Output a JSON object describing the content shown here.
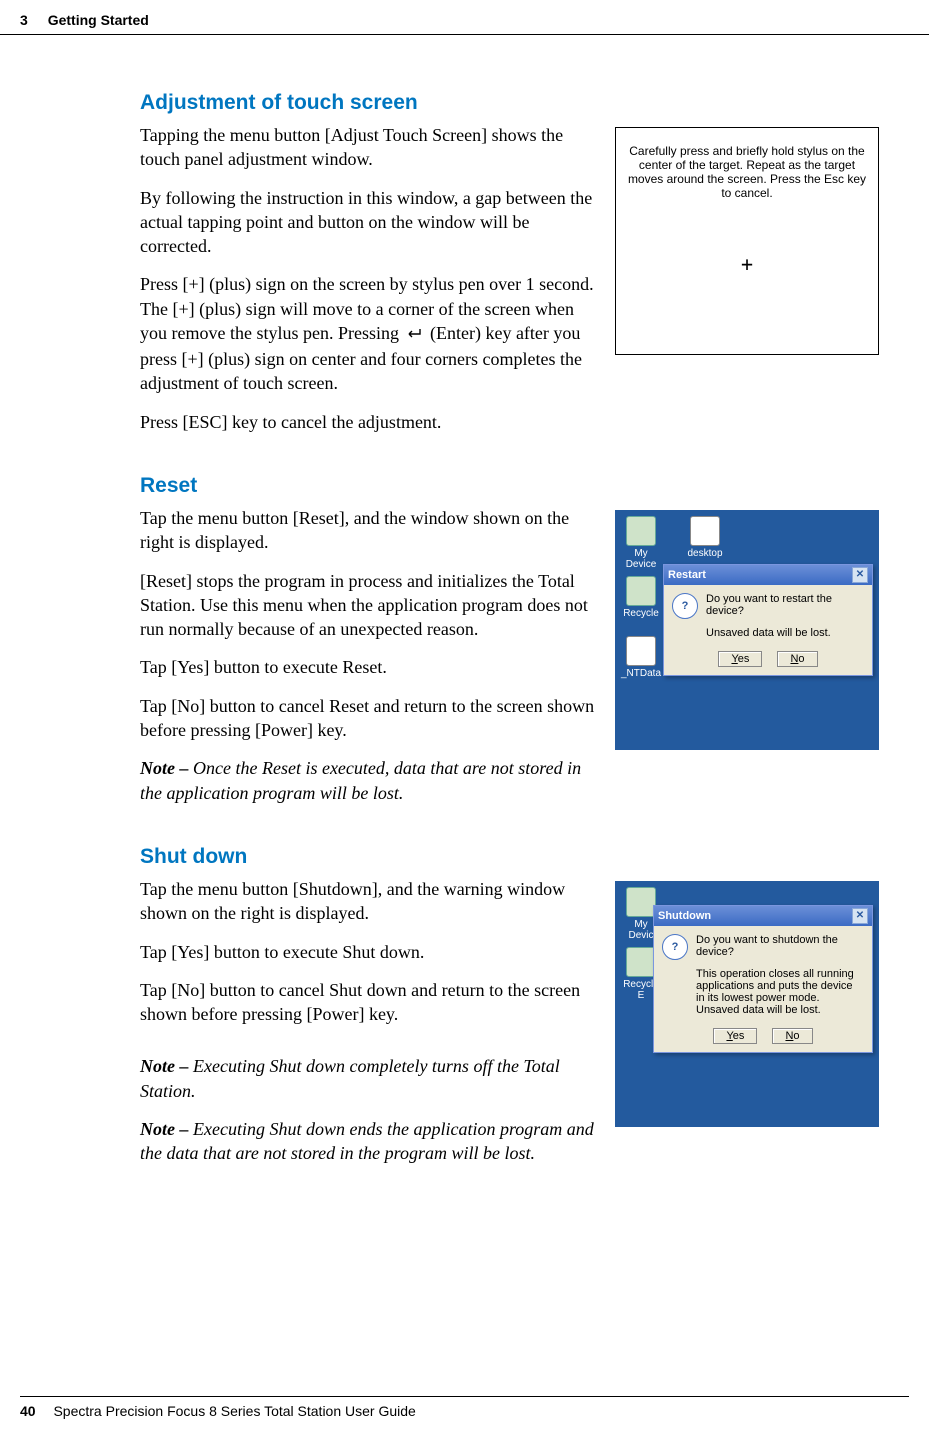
{
  "header": {
    "chapter_num": "3",
    "chapter_title": "Getting Started"
  },
  "footer": {
    "page_num": "40",
    "book_title": "Spectra Precision Focus 8 Series Total Station User Guide"
  },
  "s1": {
    "heading": "Adjustment of touch screen",
    "p1": "Tapping the menu button [Adjust Touch Screen] shows the touch panel adjustment window.",
    "p2": "By following the instruction in this window, a gap between the actual tapping point and button on the window will be corrected.",
    "p3a": "Press [+] (plus) sign on the screen by stylus pen over 1 second. The [+] (plus) sign will move to a corner of the screen when you remove the stylus pen. Pressing ",
    "p3b": " (Enter) key after you press [+] (plus) sign on center and four corners completes the adjustment of touch screen.",
    "p4": "Press [ESC] key to cancel the adjustment.",
    "calib_text": "Carefully press and briefly hold stylus on the center of the target.  Repeat as the target moves around the screen. Press the Esc key to cancel.",
    "calib_mark": "+"
  },
  "s2": {
    "heading": "Reset",
    "p1": "Tap the menu button [Reset], and the window shown on the right is displayed.",
    "p2": "[Reset] stops the program in process and initializes the Total Station. Use this menu when the application program does not run normally because of an unexpected reason.",
    "p3": "Tap [Yes] button to execute Reset.",
    "p4": "Tap [No] button to cancel Reset and return to the screen shown before pressing [Power] key.",
    "note_label": "Note – ",
    "note": "Once the Reset is executed, data that are not stored in the application program will be lost.",
    "desktop": {
      "icon1": "My Device",
      "icon2": "desktop",
      "icon3": "Recycle",
      "icon4": "_NTData"
    },
    "dialog": {
      "title": "Restart",
      "msg1": "Do you want to restart the device?",
      "msg2": "Unsaved data will be lost.",
      "yes_u": "Y",
      "yes_rest": "es",
      "no_u": "N",
      "no_rest": "o"
    }
  },
  "s3": {
    "heading": "Shut down",
    "p1": "Tap the menu button [Shutdown], and the warning window shown on the right is displayed.",
    "p2": "Tap [Yes] button to execute Shut down.",
    "p3": "Tap [No] button to cancel Shut down and return to the screen shown before pressing [Power] key.",
    "note1_label": "Note – ",
    "note1": "Executing Shut down completely turns off the Total Station.",
    "note2_label": "Note – ",
    "note2": "Executing Shut down ends the application program and the data that are not stored in the program will be lost.",
    "desktop": {
      "icon1": "My Devic",
      "icon3": "Recycle E"
    },
    "dialog": {
      "title": "Shutdown",
      "msg1": "Do you want to shutdown the device?",
      "msg2": "This operation closes all running applications and puts the device in its lowest power mode. Unsaved data will be lost.",
      "yes_u": "Y",
      "yes_rest": "es",
      "no_u": "N",
      "no_rest": "o"
    }
  }
}
